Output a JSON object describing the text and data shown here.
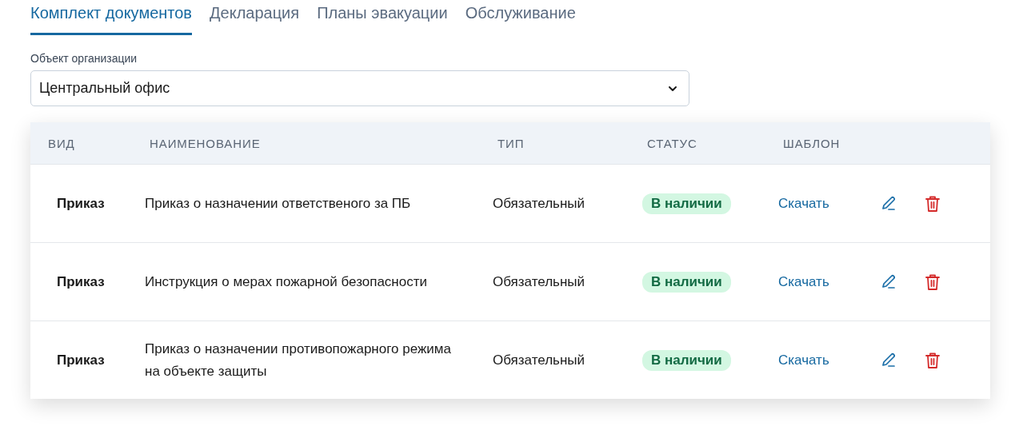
{
  "tabs": [
    {
      "label": "Комплект документов",
      "selected": true
    },
    {
      "label": "Декларация",
      "selected": false
    },
    {
      "label": "Планы эвакуации",
      "selected": false
    },
    {
      "label": "Обслуживание",
      "selected": false
    }
  ],
  "object_select": {
    "label": "Объект организации",
    "value": "Центральный офис"
  },
  "table": {
    "columns": [
      "ВИД",
      "НАИМЕНОВАНИЕ",
      "ТИП",
      "СТАТУС",
      "ШАБЛОН"
    ],
    "rows": [
      {
        "kind": "Приказ",
        "name": "Приказ о назначении ответственого за ПБ",
        "type": "Обязательный",
        "status": "В наличии",
        "template": "Скачать"
      },
      {
        "kind": "Приказ",
        "name": "Инструкция о мерах пожарной безопасности",
        "type": "Обязательный",
        "status": "В наличии",
        "template": "Скачать"
      },
      {
        "kind": "Приказ",
        "name": "Приказ о назначении противопожарного режима на объекте защиты",
        "type": "Обязательный",
        "status": "В наличии",
        "template": "Скачать"
      }
    ]
  }
}
